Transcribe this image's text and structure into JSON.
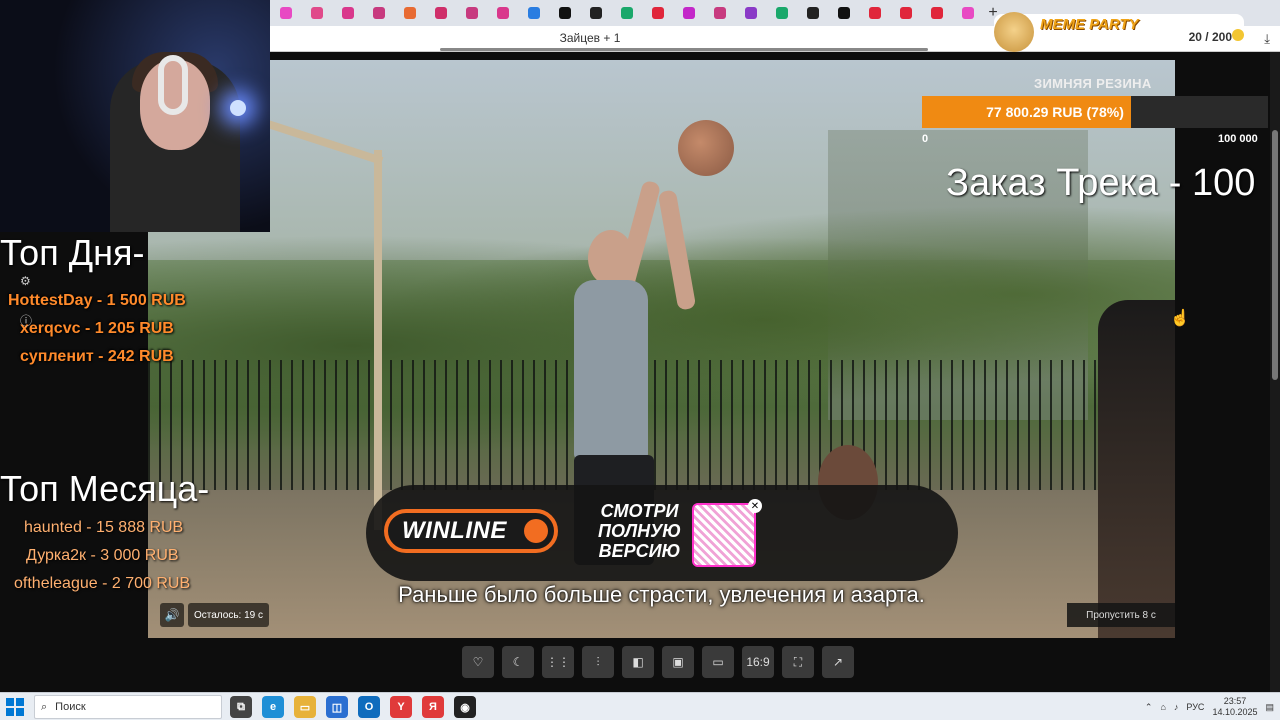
{
  "browser": {
    "tab_colors": [
      "#e84ac3",
      "#e04a8a",
      "#d9388c",
      "#c73a7f",
      "#e86b33",
      "#cf2f6a",
      "#c73a7f",
      "#d9388c",
      "#2a7de1",
      "#111111",
      "#222222",
      "#1aa86b",
      "#e0263b",
      "#c328c9",
      "#c73a7f",
      "#8a3ac7",
      "#1aa86b",
      "#222222",
      "#111111",
      "#e0263b",
      "#e0263b",
      "#e0263b",
      "#e84ac3"
    ],
    "address_text": "Зайцев + 1",
    "new_tab_label": "+"
  },
  "overlays": {
    "top_day_title": "Топ Дня-",
    "top_day": [
      "HottestDay - 1 500 RUB",
      "xerqcvc - 1 205 RUB",
      "супленит - 242 RUB"
    ],
    "top_month_title": "Топ Месяца-",
    "top_month": [
      "haunted - 15 888 RUB",
      "Дурка2к - 3 000 RUB",
      "oftheleague - 2 700 RUB"
    ],
    "meme_party": {
      "title": "MEME PARTY",
      "count": "20 / 200"
    },
    "goal": {
      "label": "ЗИМНЯЯ РЕЗИНА",
      "text": "77 800.29 RUB (78%)",
      "progress": 0.78,
      "min": "0",
      "max": "100 000"
    },
    "track_order": "Заказ Трека - 100"
  },
  "video": {
    "ad_brand": "WINLINE",
    "ad_cta": "СМОТРИ\nПОЛНУЮ\nВЕРСИЮ",
    "subtitle": "Раньше было больше страсти, увлечения и азарта.",
    "remaining": "Осталось: 19 с",
    "skip": "Пропустить 8 с"
  },
  "controls": [
    "like-icon",
    "moon-icon",
    "grid-icon",
    "audio-icon",
    "mirror-icon",
    "picture-icon",
    "pip-icon",
    "16:9",
    "fullscreen-icon",
    "open-external-icon"
  ],
  "taskbar": {
    "search_placeholder": "Поиск",
    "lang": "РУС",
    "time": "23:57",
    "date": "14.10.2025"
  }
}
